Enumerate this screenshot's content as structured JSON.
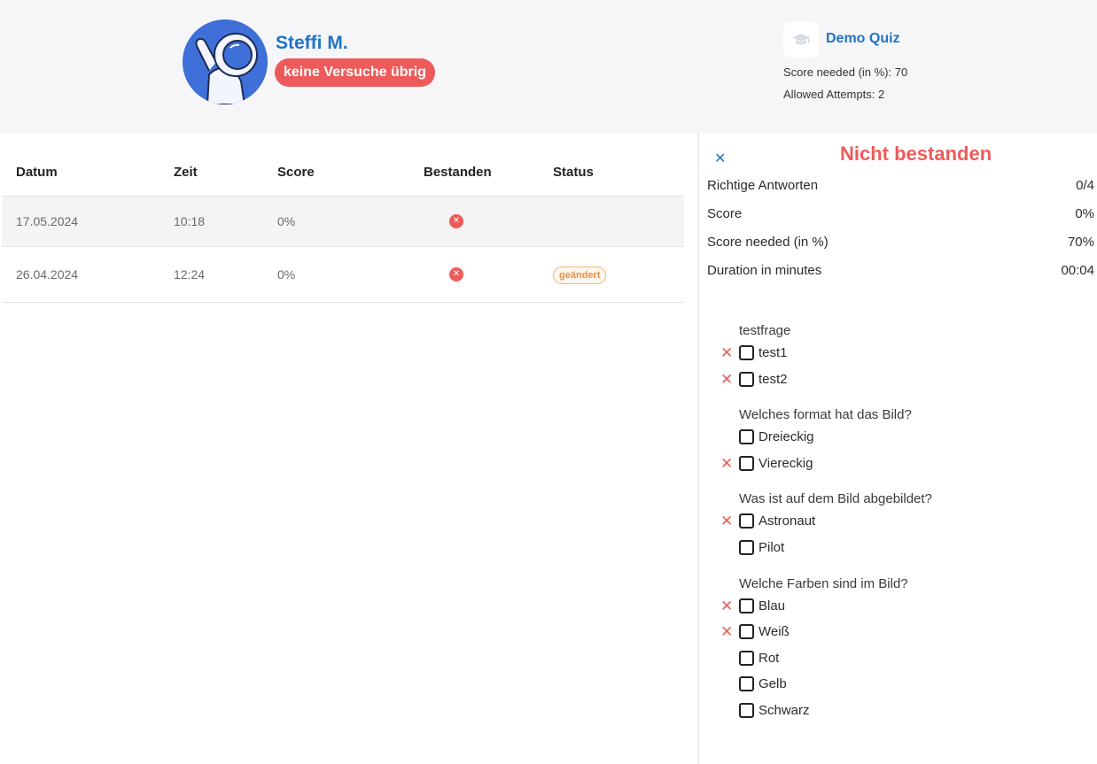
{
  "user": {
    "name": "Steffi M.",
    "attempts_badge": "keine Versuche übrig"
  },
  "quiz": {
    "title": "Demo Quiz",
    "score_needed": "Score needed (in %): 70",
    "allowed_attempts": "Allowed Attempts: 2"
  },
  "table": {
    "headers": [
      "Datum",
      "Zeit",
      "Score",
      "Bestanden",
      "Status"
    ],
    "rows": [
      {
        "datum": "17.05.2024",
        "zeit": "10:18",
        "score": "0%",
        "bestanden": "✕",
        "status": ""
      },
      {
        "datum": "26.04.2024",
        "zeit": "12:24",
        "score": "0%",
        "bestanden": "✕",
        "status": "geändert"
      }
    ]
  },
  "result": {
    "close": "✕",
    "title": "Nicht bestanden",
    "stats": [
      {
        "label": "Richtige Antworten",
        "value": "0/4"
      },
      {
        "label": "Score",
        "value": "0%"
      },
      {
        "label": "Score needed (in %)",
        "value": "70%"
      },
      {
        "label": "Duration in minutes",
        "value": "00:04"
      }
    ]
  },
  "questions": [
    {
      "title": "testfrage",
      "answers": [
        {
          "text": "test1",
          "mark": "✕"
        },
        {
          "text": "test2",
          "mark": "✕"
        }
      ]
    },
    {
      "title": "Welches format hat das Bild?",
      "answers": [
        {
          "text": "Dreieckig",
          "mark": ""
        },
        {
          "text": "Viereckig",
          "mark": "✕"
        }
      ]
    },
    {
      "title": "Was ist auf dem Bild abgebildet?",
      "answers": [
        {
          "text": "Astronaut",
          "mark": "✕"
        },
        {
          "text": "Pilot",
          "mark": ""
        }
      ]
    },
    {
      "title": "Welche Farben sind im Bild?",
      "answers": [
        {
          "text": "Blau",
          "mark": "✕"
        },
        {
          "text": "Weiß",
          "mark": "✕"
        },
        {
          "text": "Rot",
          "mark": ""
        },
        {
          "text": "Gelb",
          "mark": ""
        },
        {
          "text": "Schwarz",
          "mark": ""
        }
      ]
    }
  ],
  "colors": {
    "accent": "#1f73c4",
    "error": "#ee5a5a",
    "warning": "#e7904a"
  },
  "icons": {
    "avatar": "astronaut-avatar",
    "quiz": "graduation-cap-icon"
  }
}
